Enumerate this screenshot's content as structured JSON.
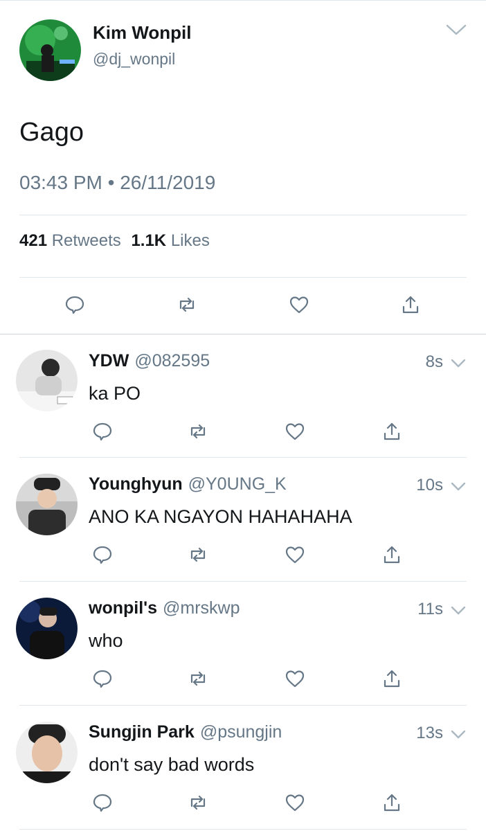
{
  "tweet": {
    "author_name": "Kim Wonpil",
    "author_handle": "@dj_wonpil",
    "text": "Gago",
    "time": "03:43 PM",
    "separator": "•",
    "date": "26/11/2019",
    "retweets_count": "421",
    "retweets_label": "Retweets",
    "likes_count": "1.1K",
    "likes_label": "Likes"
  },
  "replies": [
    {
      "name": "YDW",
      "handle": "@082595",
      "time": "8s",
      "text": "ka PO"
    },
    {
      "name": "Younghyun",
      "handle": "@Y0UNG_K",
      "time": "10s",
      "text": "ANO KA NGAYON HAHAHAHA"
    },
    {
      "name": "wonpil's",
      "handle": "@mrskwp",
      "time": "11s",
      "text": "who"
    },
    {
      "name": "Sungjin Park",
      "handle": "@psungjin",
      "time": "13s",
      "text": "don't say bad words"
    }
  ],
  "colors": {
    "text": "#14171a",
    "secondary": "#657786",
    "divider": "#e1e8ed"
  }
}
